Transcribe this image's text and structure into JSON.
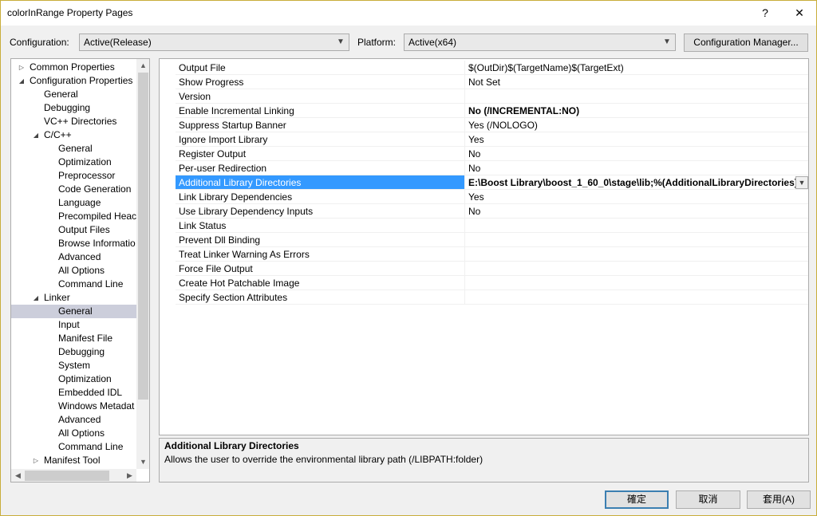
{
  "window": {
    "title": "colorInRange Property Pages",
    "help_label": "?",
    "close_label": "✕"
  },
  "config_bar": {
    "configuration_label": "Configuration:",
    "configuration_value": "Active(Release)",
    "platform_label": "Platform:",
    "platform_value": "Active(x64)",
    "config_manager_label": "Configuration Manager..."
  },
  "tree": {
    "items": [
      {
        "label": "Common Properties",
        "expander": "▷"
      },
      {
        "label": "Configuration Properties",
        "expander": "◢"
      },
      {
        "label": "General"
      },
      {
        "label": "Debugging"
      },
      {
        "label": "VC++ Directories"
      },
      {
        "label": "C/C++",
        "expander": "◢"
      },
      {
        "label": "General"
      },
      {
        "label": "Optimization"
      },
      {
        "label": "Preprocessor"
      },
      {
        "label": "Code Generation"
      },
      {
        "label": "Language"
      },
      {
        "label": "Precompiled Heac"
      },
      {
        "label": "Output Files"
      },
      {
        "label": "Browse Informatio"
      },
      {
        "label": "Advanced"
      },
      {
        "label": "All Options"
      },
      {
        "label": "Command Line"
      },
      {
        "label": "Linker",
        "expander": "◢"
      },
      {
        "label": "General",
        "selected": true
      },
      {
        "label": "Input"
      },
      {
        "label": "Manifest File"
      },
      {
        "label": "Debugging"
      },
      {
        "label": "System"
      },
      {
        "label": "Optimization"
      },
      {
        "label": "Embedded IDL"
      },
      {
        "label": "Windows Metadat"
      },
      {
        "label": "Advanced"
      },
      {
        "label": "All Options"
      },
      {
        "label": "Command Line"
      },
      {
        "label": "Manifest Tool",
        "expander": "▷"
      }
    ]
  },
  "properties": [
    {
      "name": "Output File",
      "value": "$(OutDir)$(TargetName)$(TargetExt)"
    },
    {
      "name": "Show Progress",
      "value": "Not Set"
    },
    {
      "name": "Version",
      "value": ""
    },
    {
      "name": "Enable Incremental Linking",
      "value": "No (/INCREMENTAL:NO)",
      "bold": true
    },
    {
      "name": "Suppress Startup Banner",
      "value": "Yes (/NOLOGO)"
    },
    {
      "name": "Ignore Import Library",
      "value": "Yes"
    },
    {
      "name": "Register Output",
      "value": "No"
    },
    {
      "name": "Per-user Redirection",
      "value": "No"
    },
    {
      "name": "Additional Library Directories",
      "value": "E:\\Boost Library\\boost_1_60_0\\stage\\lib;%(AdditionalLibraryDirectories)",
      "selected": true
    },
    {
      "name": "Link Library Dependencies",
      "value": "Yes"
    },
    {
      "name": "Use Library Dependency Inputs",
      "value": "No"
    },
    {
      "name": "Link Status",
      "value": ""
    },
    {
      "name": "Prevent Dll Binding",
      "value": ""
    },
    {
      "name": "Treat Linker Warning As Errors",
      "value": ""
    },
    {
      "name": "Force File Output",
      "value": ""
    },
    {
      "name": "Create Hot Patchable Image",
      "value": ""
    },
    {
      "name": "Specify Section Attributes",
      "value": ""
    }
  ],
  "description": {
    "title": "Additional Library Directories",
    "text": "Allows the user to override the environmental library path (/LIBPATH:folder)"
  },
  "buttons": {
    "ok": "確定",
    "cancel": "取消",
    "apply": "套用(A)"
  },
  "colors": {
    "selection": "#3399ff",
    "tree_selection": "#cccedb",
    "default_button_border": "#3c7fb1"
  }
}
